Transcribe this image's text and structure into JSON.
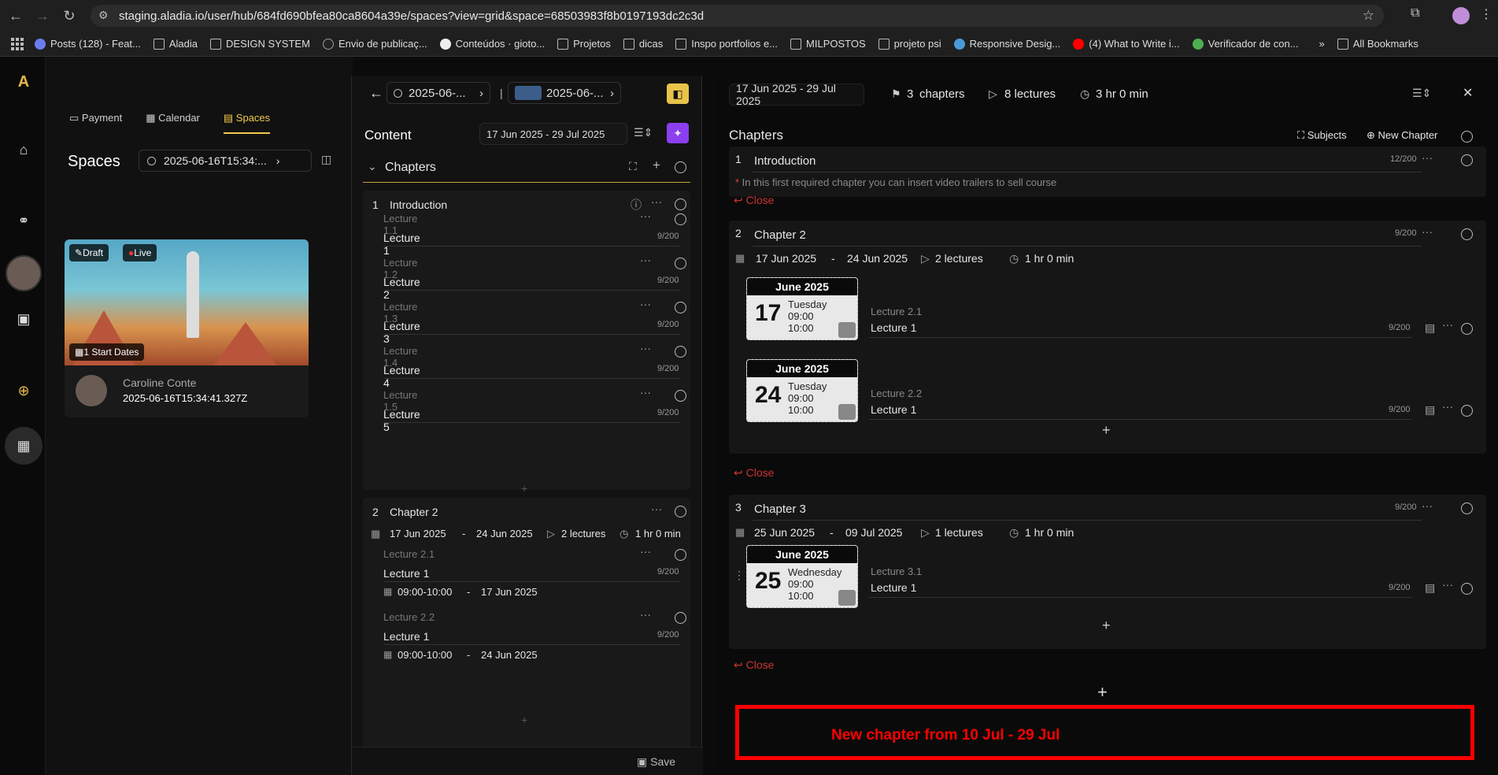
{
  "browser": {
    "url": "staging.aladia.io/user/hub/684fd690bfea80ca8604a39e/spaces?view=grid&space=68503983f8b0197193dc2c3d"
  },
  "bookmarks": [
    "Posts (128) - Feat...",
    "Aladia",
    "DESIGN SYSTEM",
    "Envio de publicaç...",
    "Conteúdos · gioto...",
    "Projetos",
    "dicas",
    "Inspo portfolios e...",
    "MILPOSTOS",
    "projeto psi",
    "Responsive Desig...",
    "(4) What to Write i...",
    "Verificador de con...",
    "All Bookmarks"
  ],
  "hub": {
    "tabs": [
      "Payment",
      "Calendar",
      "Spaces"
    ],
    "spaces_title": "Spaces",
    "space_selector": "2025-06-16T15:34:...",
    "card": {
      "draft": "Draft",
      "live": "Live",
      "start_dates": "1 Start Dates",
      "owner": "Caroline Conte",
      "timestamp": "2025-06-16T15:34:41.327Z"
    }
  },
  "middle": {
    "crumb1": "2025-06-...",
    "crumb2": "2025-06-...",
    "content_label": "Content",
    "date_range": "17 Jun 2025 - 29 Jul 2025",
    "chapters_label": "Chapters",
    "intro": {
      "num": "1",
      "title": "Introduction"
    },
    "lectures": [
      {
        "code": "Lecture 1.1",
        "title": "Lecture 1",
        "count": "9/200"
      },
      {
        "code": "Lecture 1.2",
        "title": "Lecture 2",
        "count": "9/200"
      },
      {
        "code": "Lecture 1.3",
        "title": "Lecture 3",
        "count": "9/200"
      },
      {
        "code": "Lecture 1.4",
        "title": "Lecture 4",
        "count": "9/200"
      },
      {
        "code": "Lecture 1.5",
        "title": "Lecture 5",
        "count": "9/200"
      }
    ],
    "ch2": {
      "num": "2",
      "title": "Chapter 2",
      "start": "17 Jun 2025",
      "dash": "-",
      "end": "24 Jun 2025",
      "lectures": "2 lectures",
      "duration": "1 hr 0 min"
    },
    "ch2_lectures": [
      {
        "code": "Lecture 2.1",
        "title": "Lecture 1",
        "count": "9/200",
        "time": "09:00-10:00",
        "dash": "-",
        "date": "17 Jun 2025"
      },
      {
        "code": "Lecture 2.2",
        "title": "Lecture 1",
        "count": "9/200",
        "time": "09:00-10:00",
        "dash": "-",
        "date": "24 Jun 2025"
      }
    ],
    "save": "Save"
  },
  "right": {
    "date_range": "17 Jun 2025 - 29 Jul 2025",
    "chapters_count": "3",
    "chapters_word": "chapters",
    "lectures": "8 lectures",
    "duration": "3 hr 0 min",
    "chapters_label": "Chapters",
    "subjects": "Subjects",
    "new_chapter": "New Chapter",
    "close": "Close",
    "ch1": {
      "num": "1",
      "title": "Introduction",
      "count": "12/200",
      "note": "In this first required chapter you can insert video trailers to sell course"
    },
    "ch2": {
      "num": "2",
      "title": "Chapter 2",
      "count": "9/200",
      "start": "17 Jun 2025",
      "dash": "-",
      "end": "24 Jun 2025",
      "lectures": "2 lectures",
      "duration": "1 hr 0 min",
      "items": [
        {
          "month": "June 2025",
          "day": "17",
          "weekday": "Tuesday",
          "t1": "09:00",
          "t2": "10:00",
          "code": "Lecture 2.1",
          "title": "Lecture 1",
          "count": "9/200"
        },
        {
          "month": "June 2025",
          "day": "24",
          "weekday": "Tuesday",
          "t1": "09:00",
          "t2": "10:00",
          "code": "Lecture 2.2",
          "title": "Lecture 1",
          "count": "9/200"
        }
      ]
    },
    "ch3": {
      "num": "3",
      "title": "Chapter 3",
      "count": "9/200",
      "start": "25 Jun 2025",
      "dash": "-",
      "end": "09 Jul 2025",
      "lectures": "1 lectures",
      "duration": "1 hr 0 min",
      "item": {
        "month": "June 2025",
        "day": "25",
        "weekday": "Wednesday",
        "t1": "09:00",
        "t2": "10:00",
        "code": "Lecture 3.1",
        "title": "Lecture 1",
        "count": "9/200"
      }
    },
    "annotation": "New chapter from 10 Jul - 29 Jul"
  }
}
